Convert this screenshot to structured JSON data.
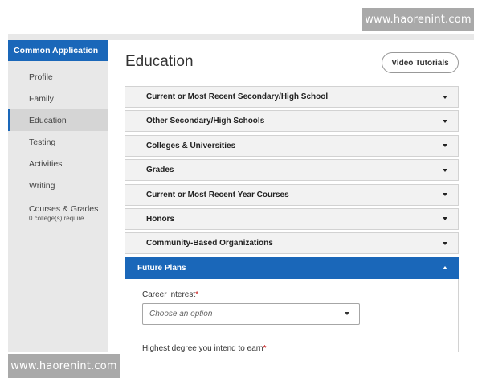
{
  "watermark": {
    "top": "www.haorenint.com",
    "bottom": "www.haorenint.com"
  },
  "sidebar": {
    "header": "Common Application",
    "items": [
      {
        "label": "Profile"
      },
      {
        "label": "Family"
      },
      {
        "label": "Education",
        "active": true
      },
      {
        "label": "Testing"
      },
      {
        "label": "Activities"
      },
      {
        "label": "Writing"
      },
      {
        "label": "Courses & Grades",
        "sub": "0 college(s) require"
      }
    ]
  },
  "main": {
    "title": "Education",
    "video_button": "Video Tutorials",
    "sections": [
      "Current or Most Recent Secondary/High School",
      "Other Secondary/High Schools",
      "Colleges & Universities",
      "Grades",
      "Current or Most Recent Year Courses",
      "Honors",
      "Community-Based Organizations"
    ],
    "open_section": {
      "title": "Future Plans",
      "career_label": "Career interest",
      "required_mark": "*",
      "career_placeholder": "Choose an option",
      "degree_label": "Highest degree you intend to earn"
    }
  },
  "colors": {
    "accent": "#1a67b9",
    "sidebar_bg": "#e8e8e8",
    "required": "#c41212"
  }
}
